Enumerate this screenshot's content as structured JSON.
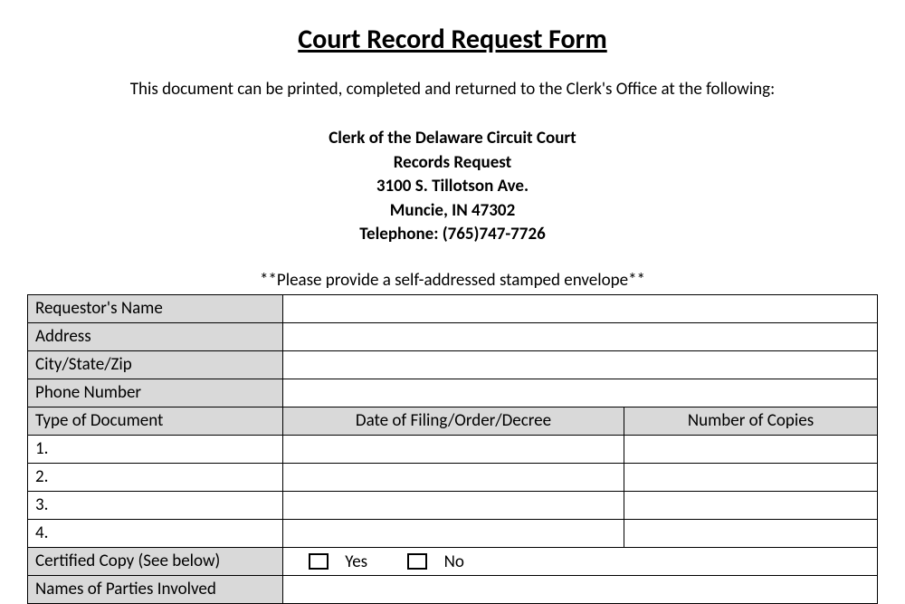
{
  "title": "Court Record Request Form",
  "intro": "This document can be printed, completed and returned to the Clerk's Office at the following:",
  "address": {
    "line1": "Clerk of the Delaware Circuit Court",
    "line2": "Records Request",
    "line3": "3100 S. Tillotson Ave.",
    "line4": "Muncie, IN  47302",
    "line5": "Telephone:  (765)747-7726"
  },
  "envelope_note": "**Please provide a self-addressed stamped envelope**",
  "labels": {
    "requestor_name": "Requestor's Name",
    "address": "Address",
    "city_state_zip": "City/State/Zip",
    "phone": "Phone Number",
    "type_of_document": "Type of Document",
    "date_of_filing": "Date of Filing/Order/Decree",
    "number_of_copies": "Number of Copies",
    "certified_copy": "Certified Copy (See below)",
    "names_of_parties": "Names of Parties Involved"
  },
  "rows": {
    "r1": "1.",
    "r2": "2.",
    "r3": "3.",
    "r4": "4."
  },
  "yes": "Yes",
  "no": "No"
}
